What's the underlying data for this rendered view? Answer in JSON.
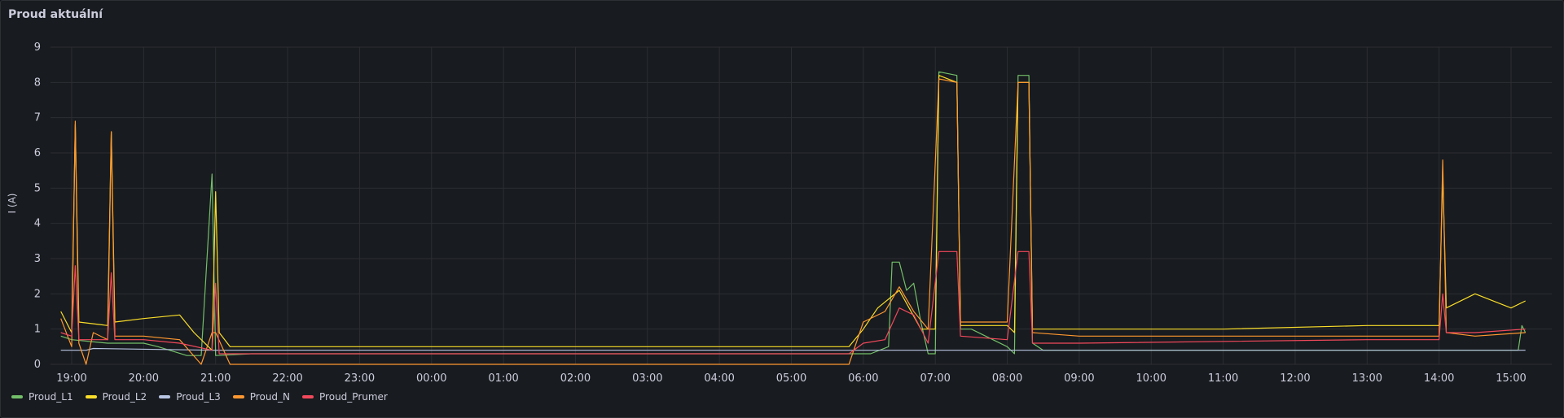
{
  "panel": {
    "title": "Proud aktuální"
  },
  "chart_data": {
    "type": "line",
    "ylabel": "I (A)",
    "ylim": [
      0,
      9
    ],
    "yticks": [
      0,
      1,
      2,
      3,
      4,
      5,
      6,
      7,
      8,
      9
    ],
    "x_tick_labels": [
      "19:00",
      "20:00",
      "21:00",
      "22:00",
      "23:00",
      "00:00",
      "01:00",
      "02:00",
      "03:00",
      "04:00",
      "05:00",
      "06:00",
      "07:00",
      "08:00",
      "09:00",
      "10:00",
      "11:00",
      "12:00",
      "13:00",
      "14:00",
      "15:00"
    ],
    "x_unit": "hours since 19:00",
    "xlim": [
      -0.2,
      20.25
    ],
    "series": [
      {
        "name": "Proud_L1",
        "color": "#73bf69",
        "points": [
          [
            -0.15,
            0.8
          ],
          [
            0,
            0.7
          ],
          [
            0.5,
            0.6
          ],
          [
            1.0,
            0.6
          ],
          [
            1.2,
            0.5
          ],
          [
            1.6,
            0.25
          ],
          [
            1.8,
            0.25
          ],
          [
            1.95,
            5.4
          ],
          [
            2.0,
            0.25
          ],
          [
            2.5,
            0.3
          ],
          [
            3,
            0.3
          ],
          [
            6,
            0.3
          ],
          [
            10.8,
            0.3
          ],
          [
            11.1,
            0.3
          ],
          [
            11.35,
            0.5
          ],
          [
            11.4,
            2.9
          ],
          [
            11.5,
            2.9
          ],
          [
            11.6,
            2.1
          ],
          [
            11.7,
            2.3
          ],
          [
            11.8,
            1.2
          ],
          [
            11.9,
            0.3
          ],
          [
            12.0,
            0.3
          ],
          [
            12.05,
            8.3
          ],
          [
            12.3,
            8.2
          ],
          [
            12.35,
            1.0
          ],
          [
            12.5,
            1.0
          ],
          [
            12.8,
            0.7
          ],
          [
            13.0,
            0.5
          ],
          [
            13.1,
            0.3
          ],
          [
            13.15,
            8.2
          ],
          [
            13.3,
            8.2
          ],
          [
            13.35,
            0.6
          ],
          [
            13.5,
            0.4
          ],
          [
            14,
            0.4
          ],
          [
            17,
            0.4
          ],
          [
            19,
            0.4
          ],
          [
            20.1,
            0.4
          ],
          [
            20.15,
            1.1
          ],
          [
            20.2,
            0.9
          ]
        ]
      },
      {
        "name": "Proud_L2",
        "color": "#fade2a",
        "points": [
          [
            -0.15,
            1.5
          ],
          [
            0,
            0.9
          ],
          [
            0.05,
            6.8
          ],
          [
            0.1,
            1.2
          ],
          [
            0.5,
            1.1
          ],
          [
            0.55,
            6.6
          ],
          [
            0.6,
            1.2
          ],
          [
            1.0,
            1.3
          ],
          [
            1.5,
            1.4
          ],
          [
            1.7,
            0.9
          ],
          [
            1.95,
            0.4
          ],
          [
            2.0,
            4.9
          ],
          [
            2.05,
            0.9
          ],
          [
            2.2,
            0.5
          ],
          [
            3,
            0.5
          ],
          [
            6,
            0.5
          ],
          [
            9,
            0.5
          ],
          [
            10.8,
            0.5
          ],
          [
            11.0,
            1.0
          ],
          [
            11.2,
            1.6
          ],
          [
            11.5,
            2.1
          ],
          [
            11.8,
            1.0
          ],
          [
            12.0,
            1.0
          ],
          [
            12.05,
            8.2
          ],
          [
            12.3,
            8.0
          ],
          [
            12.35,
            1.1
          ],
          [
            13.0,
            1.1
          ],
          [
            13.1,
            0.9
          ],
          [
            13.15,
            8.0
          ],
          [
            13.3,
            8.0
          ],
          [
            13.35,
            1.0
          ],
          [
            14,
            1.0
          ],
          [
            16,
            1.0
          ],
          [
            18,
            1.1
          ],
          [
            19.0,
            1.1
          ],
          [
            19.05,
            5.4
          ],
          [
            19.1,
            1.6
          ],
          [
            19.5,
            2.0
          ],
          [
            20.0,
            1.6
          ],
          [
            20.2,
            1.8
          ]
        ]
      },
      {
        "name": "Proud_L3",
        "color": "#b8c5e3",
        "points": [
          [
            -0.15,
            0.4
          ],
          [
            0.2,
            0.4
          ],
          [
            0.3,
            0.45
          ],
          [
            2.0,
            0.4
          ],
          [
            10,
            0.4
          ],
          [
            15,
            0.4
          ],
          [
            20.2,
            0.4
          ]
        ]
      },
      {
        "name": "Proud_N",
        "color": "#ff9830",
        "points": [
          [
            -0.15,
            1.3
          ],
          [
            0,
            0.5
          ],
          [
            0.05,
            6.9
          ],
          [
            0.1,
            0.6
          ],
          [
            0.2,
            0.0
          ],
          [
            0.3,
            0.9
          ],
          [
            0.5,
            0.7
          ],
          [
            0.55,
            6.6
          ],
          [
            0.6,
            0.8
          ],
          [
            1.0,
            0.8
          ],
          [
            1.5,
            0.7
          ],
          [
            1.8,
            0.0
          ],
          [
            1.95,
            0.9
          ],
          [
            2.0,
            0.9
          ],
          [
            2.2,
            0.0
          ],
          [
            3,
            0.0
          ],
          [
            6,
            0.0
          ],
          [
            10.8,
            0.0
          ],
          [
            11.0,
            1.2
          ],
          [
            11.3,
            1.5
          ],
          [
            11.5,
            2.2
          ],
          [
            11.7,
            1.5
          ],
          [
            11.9,
            1.0
          ],
          [
            12.05,
            8.1
          ],
          [
            12.3,
            8.0
          ],
          [
            12.35,
            1.2
          ],
          [
            13.0,
            1.2
          ],
          [
            13.15,
            8.0
          ],
          [
            13.3,
            8.0
          ],
          [
            13.35,
            0.9
          ],
          [
            14,
            0.8
          ],
          [
            18,
            0.8
          ],
          [
            19.0,
            0.8
          ],
          [
            19.05,
            5.8
          ],
          [
            19.1,
            0.9
          ],
          [
            19.5,
            0.8
          ],
          [
            20.2,
            0.9
          ]
        ]
      },
      {
        "name": "Proud_Prumer",
        "color": "#f2495c",
        "points": [
          [
            -0.15,
            0.9
          ],
          [
            0,
            0.8
          ],
          [
            0.05,
            2.8
          ],
          [
            0.1,
            0.7
          ],
          [
            0.5,
            0.7
          ],
          [
            0.55,
            2.6
          ],
          [
            0.6,
            0.7
          ],
          [
            1.0,
            0.7
          ],
          [
            1.5,
            0.6
          ],
          [
            1.95,
            0.4
          ],
          [
            2.0,
            2.3
          ],
          [
            2.05,
            0.3
          ],
          [
            2.5,
            0.3
          ],
          [
            6,
            0.3
          ],
          [
            10.8,
            0.3
          ],
          [
            11.0,
            0.6
          ],
          [
            11.3,
            0.7
          ],
          [
            11.5,
            1.6
          ],
          [
            11.7,
            1.4
          ],
          [
            11.9,
            0.6
          ],
          [
            12.05,
            3.2
          ],
          [
            12.3,
            3.2
          ],
          [
            12.35,
            0.8
          ],
          [
            13.0,
            0.7
          ],
          [
            13.15,
            3.2
          ],
          [
            13.3,
            3.2
          ],
          [
            13.35,
            0.6
          ],
          [
            14,
            0.6
          ],
          [
            18,
            0.7
          ],
          [
            19.0,
            0.7
          ],
          [
            19.05,
            2.0
          ],
          [
            19.1,
            0.9
          ],
          [
            19.5,
            0.9
          ],
          [
            20.2,
            1.0
          ]
        ]
      }
    ]
  }
}
